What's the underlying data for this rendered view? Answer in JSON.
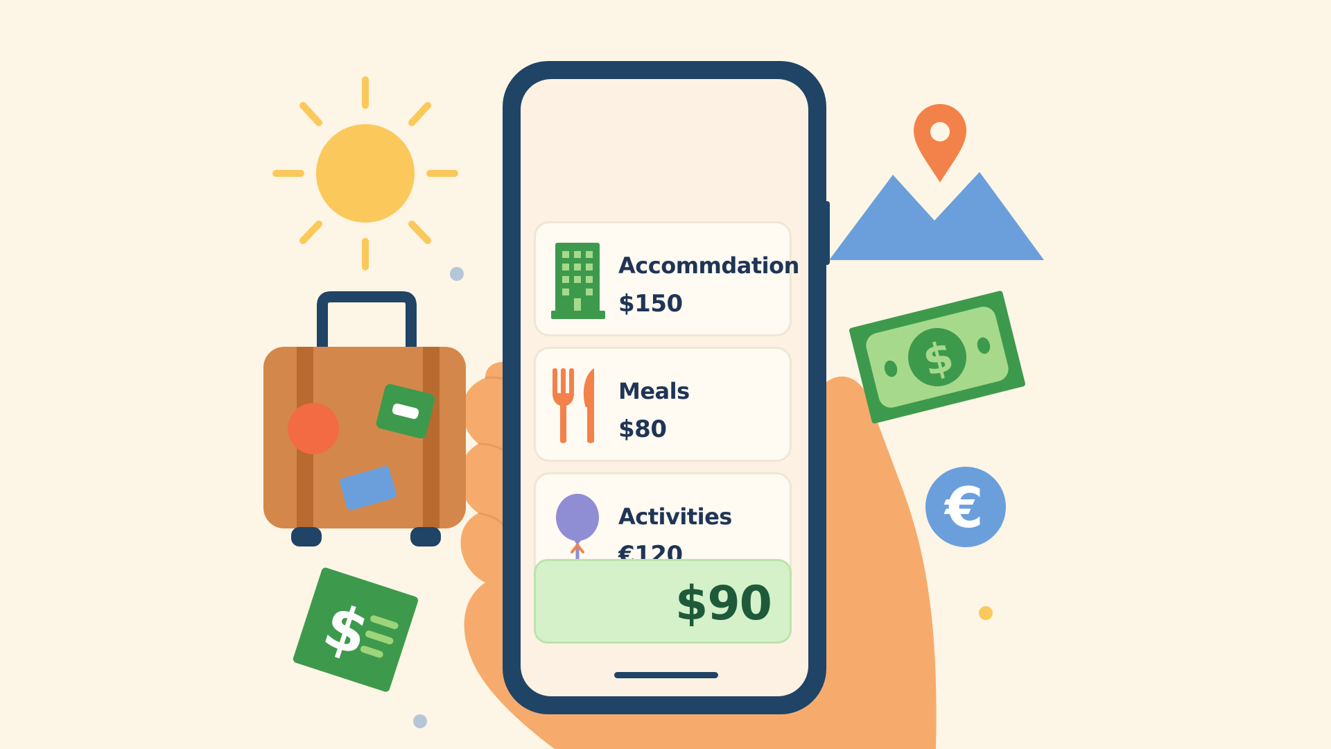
{
  "budget": {
    "items": [
      {
        "label": "Accommdation",
        "amount": "$150",
        "icon": "hotel-building-icon"
      },
      {
        "label": "Meals",
        "amount": "$80",
        "icon": "fork-knife-icon"
      },
      {
        "label": "Activities",
        "amount": "€120",
        "icon": "balloon-icon"
      }
    ],
    "total": "$90"
  },
  "decorations": {
    "banknote_symbol": "$",
    "receipt_symbol": "$",
    "coin_symbol": "€"
  },
  "colors": {
    "background": "#fdf5e6",
    "phone_frame": "#1f4466",
    "screen": "#fcf1e3",
    "text": "#1f3556",
    "total_bg": "#d5f1c9",
    "total_text": "#1e5a3a",
    "money_green": "#3d9a4c",
    "sun": "#fbc95b",
    "suitcase": "#d4874b",
    "skin": "#f6ab6c",
    "pin": "#f2824a",
    "mountain": "#6a9fdc"
  }
}
